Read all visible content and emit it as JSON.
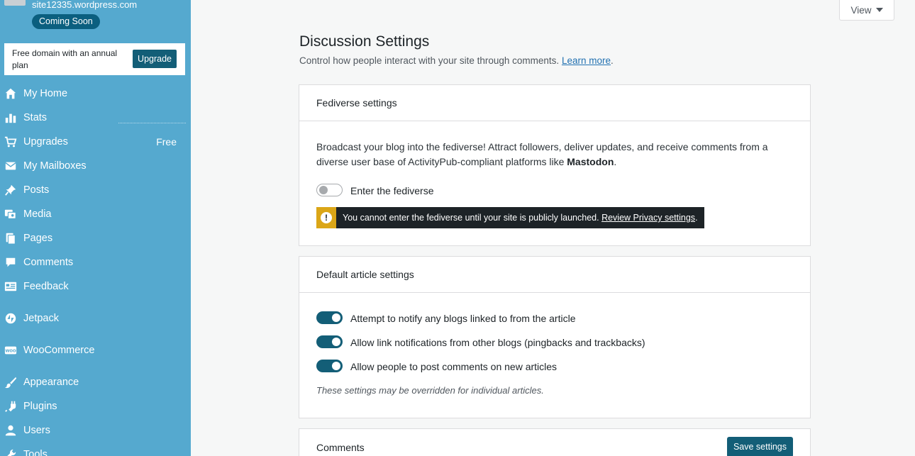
{
  "sidebar": {
    "site_url": "site12335.wordpress.com",
    "site_status": "Coming Soon",
    "upsell_text": "Free domain with an annual plan",
    "upgrade_label": "Upgrade",
    "items": [
      {
        "label": "My Home",
        "icon": "home-icon"
      },
      {
        "label": "Stats",
        "icon": "stats-icon"
      },
      {
        "label": "Upgrades",
        "icon": "cart-icon",
        "badge": "Free"
      },
      {
        "label": "My Mailboxes",
        "icon": "mail-icon"
      },
      {
        "label": "Posts",
        "icon": "pin-icon"
      },
      {
        "label": "Media",
        "icon": "media-icon"
      },
      {
        "label": "Pages",
        "icon": "pages-icon"
      },
      {
        "label": "Comments",
        "icon": "comment-icon"
      },
      {
        "label": "Feedback",
        "icon": "feedback-icon"
      },
      {
        "label": "Jetpack",
        "icon": "jetpack-icon"
      },
      {
        "label": "WooCommerce",
        "icon": "woo-icon"
      },
      {
        "label": "Appearance",
        "icon": "brush-icon"
      },
      {
        "label": "Plugins",
        "icon": "plugin-icon"
      },
      {
        "label": "Users",
        "icon": "user-icon"
      },
      {
        "label": "Tools",
        "icon": "wrench-icon"
      }
    ]
  },
  "header": {
    "view_label": "View"
  },
  "main": {
    "title": "Discussion Settings",
    "subtitle": "Control how people interact with your site through comments.",
    "learn_more": "Learn more",
    "subtitle_end": ".",
    "fediverse": {
      "heading": "Fediverse settings",
      "description": "Broadcast your blog into the fediverse! Attract followers, deliver updates, and receive comments from a diverse user base of ActivityPub-compliant platforms like",
      "description_bold": "Mastodon",
      "description_end": ".",
      "toggle_label": "Enter the fediverse",
      "toggle_on": false,
      "notice_text": "You cannot enter the fediverse until your site is publicly launched.",
      "notice_link": "Review Privacy settings",
      "notice_end": "."
    },
    "article": {
      "heading": "Default article settings",
      "options": [
        {
          "label": "Attempt to notify any blogs linked to from the article",
          "on": true
        },
        {
          "label": "Allow link notifications from other blogs (pingbacks and trackbacks)",
          "on": true
        },
        {
          "label": "Allow people to post comments on new articles",
          "on": true
        }
      ],
      "note": "These settings may be overridden for individual articles."
    },
    "comments": {
      "heading": "Comments",
      "save_label": "Save settings"
    }
  },
  "colors": {
    "sidebar_bg": "#55a9cf",
    "accent": "#135e77",
    "warning": "#dba617"
  }
}
